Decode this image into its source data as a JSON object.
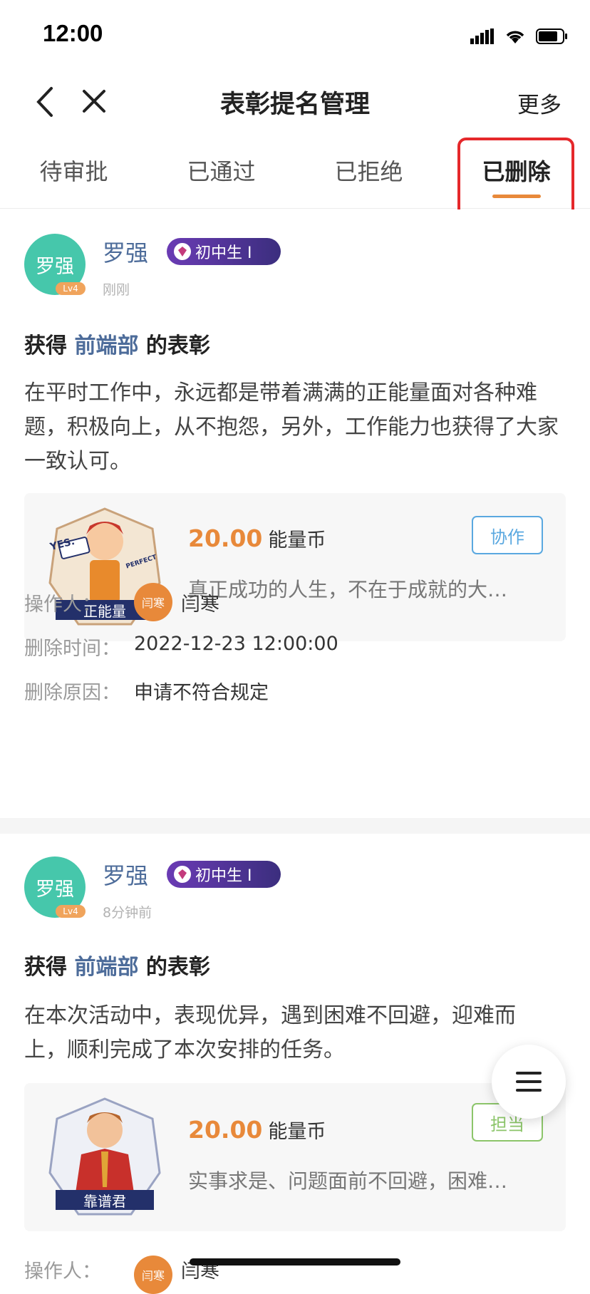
{
  "status_bar": {
    "time": "12:00"
  },
  "nav": {
    "title": "表彰提名管理",
    "more": "更多"
  },
  "tabs": [
    {
      "label": "待审批"
    },
    {
      "label": "已通过"
    },
    {
      "label": "已拒绝"
    },
    {
      "label": "已删除",
      "active": true
    }
  ],
  "cards": [
    {
      "avatar_text": "罗强",
      "level": "Lv4",
      "name": "罗强",
      "badge": "初中生 I",
      "time": "刚刚",
      "headline_prefix": "获得",
      "department": "前端部",
      "headline_suffix": "的表彰",
      "description": "在平时工作中，永远都是带着满满的正能量面对各种难题，积极向上，从不抱怨，另外，工作能力也获得了大家一致认可。",
      "award": {
        "medal_label": "正能量",
        "medal_text": "YES.",
        "medal_sub": "PERFECT",
        "amount": "20.00",
        "unit": "能量币",
        "quote": "真正成功的人生，不在于成就的大…",
        "tag": "协作",
        "tag_color": "#5aa8e0"
      },
      "operator_label": "操作人：",
      "operator_avatar": "闫寒",
      "operator_name": "闫寒",
      "delete_time_label": "删除时间：",
      "delete_time": "2022-12-23 12:00:00",
      "delete_reason_label": "删除原因：",
      "delete_reason": "申请不符合规定"
    },
    {
      "avatar_text": "罗强",
      "level": "Lv4",
      "name": "罗强",
      "badge": "初中生 I",
      "time": "8分钟前",
      "headline_prefix": "获得",
      "department": "前端部",
      "headline_suffix": "的表彰",
      "description": "在本次活动中，表现优异，遇到困难不回避，迎难而上，顺利完成了本次安排的任务。",
      "award": {
        "medal_label": "靠谱君",
        "amount": "20.00",
        "unit": "能量币",
        "quote": "实事求是、问题面前不回避，困难…",
        "tag": "担当",
        "tag_color": "#8cc56a"
      },
      "operator_label": "操作人：",
      "operator_avatar": "闫寒",
      "operator_name": "闫寒"
    }
  ],
  "colors": {
    "accent": "#e8893a",
    "highlight": "#e5282b",
    "link": "#4d6c9a"
  }
}
